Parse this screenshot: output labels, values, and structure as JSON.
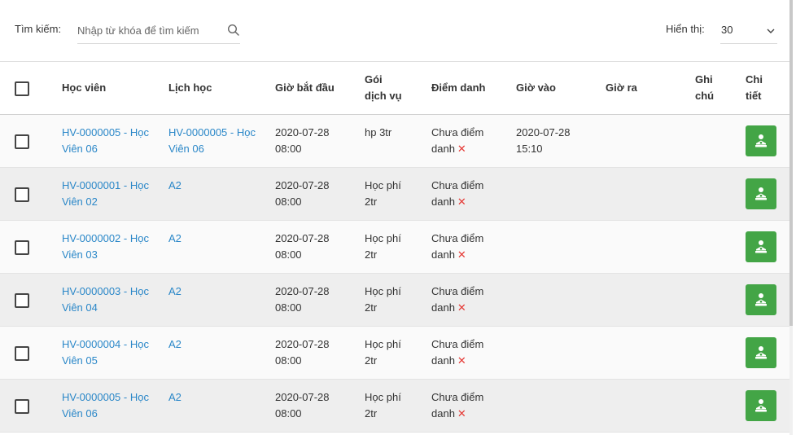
{
  "search": {
    "label": "Tìm kiếm:",
    "placeholder": "Nhập từ khóa để tìm kiếm",
    "value": "",
    "icon": "search-icon"
  },
  "display": {
    "label": "Hiển thị:",
    "value": "30",
    "icon": "chevron-down-icon"
  },
  "columns": {
    "student": "Học viên",
    "schedule": "Lịch học",
    "start": "Giờ bắt đầu",
    "package": "Gói dịch vụ",
    "attendance": "Điểm danh",
    "check_in": "Giờ vào",
    "check_out": "Giờ ra",
    "note": "Ghi chú",
    "detail": "Chi tiết"
  },
  "status_x": "✕",
  "colors": {
    "link": "#2a87c8",
    "detail_button": "#43a546",
    "x_mark": "#e53935"
  },
  "rows": [
    {
      "student": "HV-0000005 - Học Viên 06",
      "schedule": "HV-0000005 - Học Viên 06",
      "start": "2020-07-28 08:00",
      "package": "hp 3tr",
      "attendance": "Chưa điểm danh",
      "check_in": "2020-07-28 15:10",
      "check_out": "",
      "note": ""
    },
    {
      "student": "HV-0000001 - Học Viên 02",
      "schedule": "A2",
      "start": "2020-07-28 08:00",
      "package": "Học phí 2tr",
      "attendance": "Chưa điểm danh",
      "check_in": "",
      "check_out": "",
      "note": ""
    },
    {
      "student": "HV-0000002 - Học Viên 03",
      "schedule": "A2",
      "start": "2020-07-28 08:00",
      "package": "Học phí 2tr",
      "attendance": "Chưa điểm danh",
      "check_in": "",
      "check_out": "",
      "note": ""
    },
    {
      "student": "HV-0000003 - Học Viên 04",
      "schedule": "A2",
      "start": "2020-07-28 08:00",
      "package": "Học phí 2tr",
      "attendance": "Chưa điểm danh",
      "check_in": "",
      "check_out": "",
      "note": ""
    },
    {
      "student": "HV-0000004 - Học Viên 05",
      "schedule": "A2",
      "start": "2020-07-28 08:00",
      "package": "Học phí 2tr",
      "attendance": "Chưa điểm danh",
      "check_in": "",
      "check_out": "",
      "note": ""
    },
    {
      "student": "HV-0000005 - Học Viên 06",
      "schedule": "A2",
      "start": "2020-07-28 08:00",
      "package": "Học phí 2tr",
      "attendance": "Chưa điểm danh",
      "check_in": "",
      "check_out": "",
      "note": ""
    }
  ]
}
